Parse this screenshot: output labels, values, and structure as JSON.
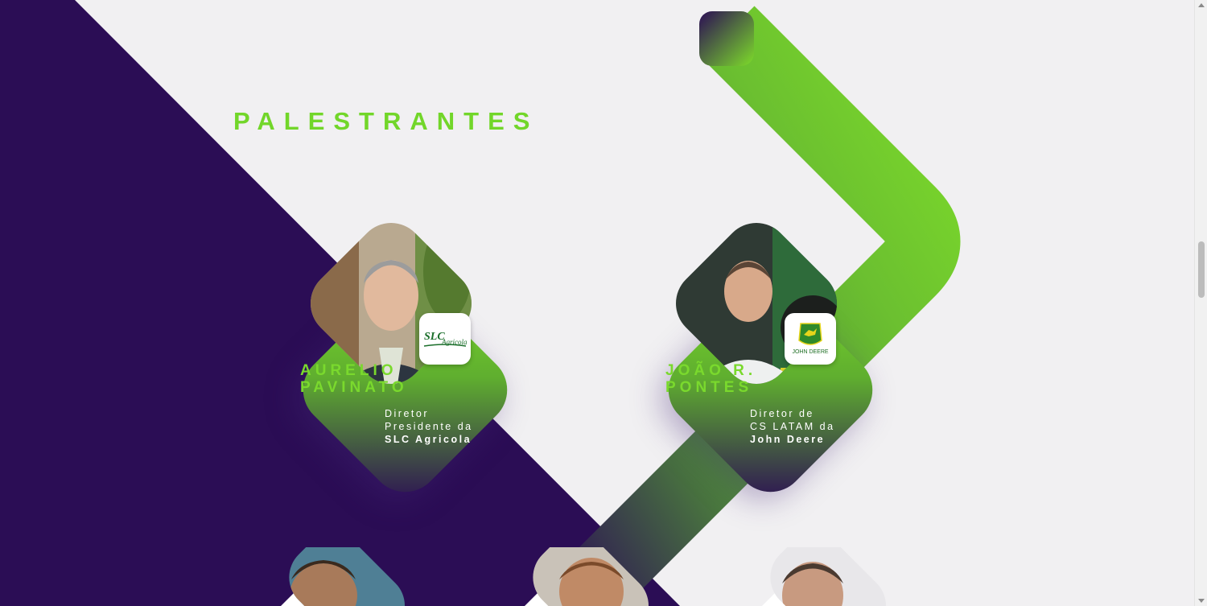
{
  "section": {
    "title": "PALESTRANTES"
  },
  "colors": {
    "purple": "#2b0d55",
    "green": "#72d62a",
    "background": "#f1f0f2"
  },
  "speakers": [
    {
      "name_line1": "AURELIO",
      "name_line2": "PAVINATO",
      "role_line1": "Diretor",
      "role_line2": "Presidente da",
      "role_line3": "SLC Agricola",
      "logo_line1": "SLC",
      "logo_line2": "Agricola"
    },
    {
      "name_line1": "JOÃO R.",
      "name_line2": "PONTES",
      "role_line1": "Diretor de",
      "role_line2": "CS LATAM da",
      "role_line3": "John Deere",
      "logo_line1": "JOHN DEERE"
    }
  ]
}
